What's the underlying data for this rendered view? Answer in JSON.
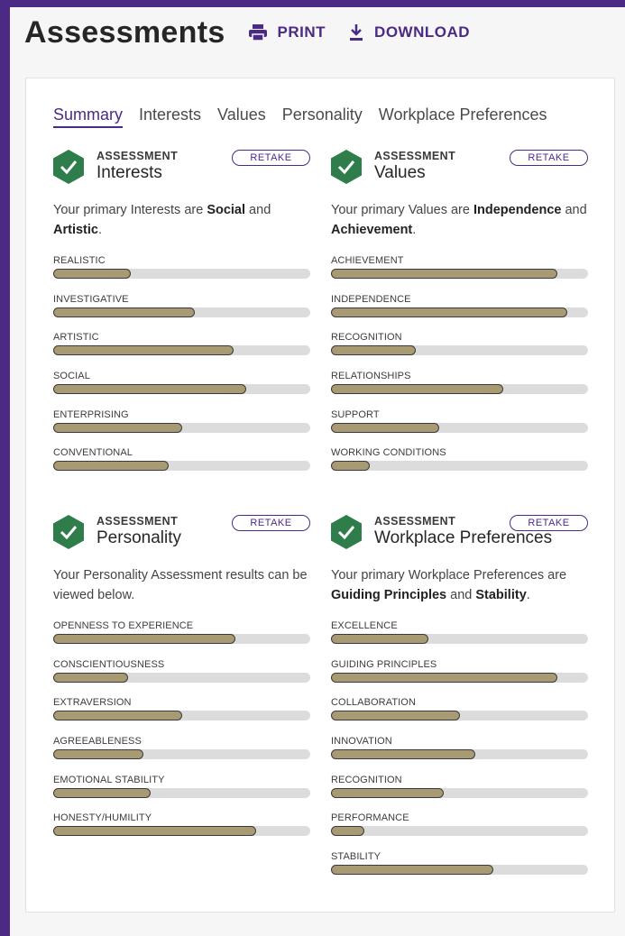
{
  "header": {
    "title": "Assessments",
    "print_label": "PRINT",
    "download_label": "DOWNLOAD"
  },
  "tabs": [
    "Summary",
    "Interests",
    "Values",
    "Personality",
    "Workplace Preferences"
  ],
  "active_tab": "Summary",
  "colors": {
    "brand": "#4b2a86",
    "badge": "#2e7d4a",
    "bar_fill": "#a89a72",
    "bar_track": "#dcdcdc"
  },
  "sections": {
    "interests": {
      "kicker": "ASSESSMENT",
      "name": "Interests",
      "retake_label": "RETAKE",
      "summary": {
        "prefix": "Your primary Interests are ",
        "first": "Social",
        "middle": " and ",
        "second": "Artistic",
        "suffix": "."
      },
      "bars": [
        {
          "label": "REALISTIC",
          "value": 0.3
        },
        {
          "label": "INVESTIGATIVE",
          "value": 0.55
        },
        {
          "label": "ARTISTIC",
          "value": 0.7
        },
        {
          "label": "SOCIAL",
          "value": 0.75
        },
        {
          "label": "ENTERPRISING",
          "value": 0.5
        },
        {
          "label": "CONVENTIONAL",
          "value": 0.45
        }
      ]
    },
    "values": {
      "kicker": "ASSESSMENT",
      "name": "Values",
      "retake_label": "RETAKE",
      "summary": {
        "prefix": "Your primary Values are ",
        "first": "Independence",
        "middle": " and ",
        "second": "Achievement",
        "suffix": "."
      },
      "bars": [
        {
          "label": "ACHIEVEMENT",
          "value": 0.88
        },
        {
          "label": "INDEPENDENCE",
          "value": 0.92
        },
        {
          "label": "RECOGNITION",
          "value": 0.33
        },
        {
          "label": "RELATIONSHIPS",
          "value": 0.67
        },
        {
          "label": "SUPPORT",
          "value": 0.42
        },
        {
          "label": "WORKING CONDITIONS",
          "value": 0.15
        }
      ]
    },
    "personality": {
      "kicker": "ASSESSMENT",
      "name": "Personality",
      "retake_label": "RETAKE",
      "summary": {
        "prefix": "Your Personality Assessment results can be viewed below.",
        "first": "",
        "middle": "",
        "second": "",
        "suffix": ""
      },
      "bars": [
        {
          "label": "OPENNESS TO EXPERIENCE",
          "value": 0.71
        },
        {
          "label": "CONSCIENTIOUSNESS",
          "value": 0.29
        },
        {
          "label": "EXTRAVERSION",
          "value": 0.5
        },
        {
          "label": "AGREEABLENESS",
          "value": 0.35
        },
        {
          "label": "EMOTIONAL STABILITY",
          "value": 0.38
        },
        {
          "label": "HONESTY/HUMILITY",
          "value": 0.79
        }
      ]
    },
    "workplace": {
      "kicker": "ASSESSMENT",
      "name": "Workplace Preferences",
      "retake_label": "RETAKE",
      "summary": {
        "prefix": "Your primary Workplace Preferences are ",
        "first": "Guiding Principles",
        "middle": " and ",
        "second": "Stability",
        "suffix": "."
      },
      "bars": [
        {
          "label": "EXCELLENCE",
          "value": 0.38
        },
        {
          "label": "GUIDING PRINCIPLES",
          "value": 0.88
        },
        {
          "label": "COLLABORATION",
          "value": 0.5
        },
        {
          "label": "INNOVATION",
          "value": 0.56
        },
        {
          "label": "RECOGNITION",
          "value": 0.44
        },
        {
          "label": "PERFORMANCE",
          "value": 0.13
        },
        {
          "label": "STABILITY",
          "value": 0.63
        }
      ]
    }
  }
}
